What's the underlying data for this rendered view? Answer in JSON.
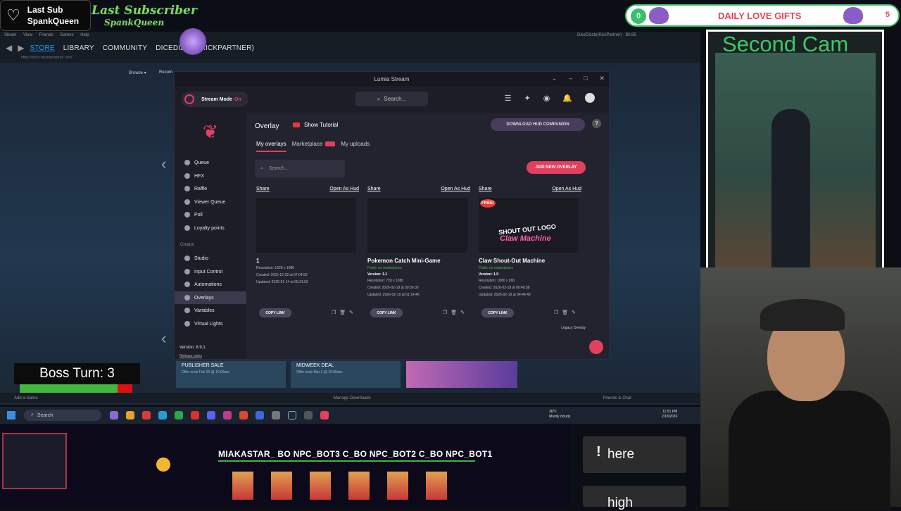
{
  "steam": {
    "menu": [
      "Steam",
      "View",
      "Friends",
      "Games",
      "Help"
    ],
    "nav": [
      "STORE",
      "LIBRARY",
      "COMMUNITY",
      "DICEDIZZLE(KICKPARTNER)"
    ],
    "url": "https://store.steampowered.com/",
    "browse": "Browse ▾",
    "recommended": "Recom",
    "account": "DiceDizzle(KickPartner) · $0.85",
    "tiles": [
      {
        "title": "PUBLISHER SALE",
        "sub": "Offer ends Feb 23 @ 10:00am."
      },
      {
        "title": "MIDWEEK DEAL",
        "sub": "Offer ends Mar 2 @ 10:00am."
      }
    ],
    "add_game": "Add a Game",
    "manage_downloads": "Manage Downloads",
    "friends_chat": "Friends & Chat"
  },
  "lumia": {
    "window_title": "Lumia Stream",
    "stream_mode_label": "Stream Mode",
    "stream_mode_state": "On",
    "search_placeholder": "Search...",
    "notification_count": "2",
    "sidebar": {
      "items": [
        {
          "label": "Queue",
          "icon": "queue-icon"
        },
        {
          "label": "HFX",
          "icon": "hfx-icon"
        },
        {
          "label": "Raffle",
          "icon": "raffle-icon"
        },
        {
          "label": "Viewer Queue",
          "icon": "viewer-queue-icon"
        },
        {
          "label": "Poll",
          "icon": "poll-icon"
        },
        {
          "label": "Loyalty points",
          "icon": "loyalty-icon"
        }
      ],
      "creator_label": "Creator",
      "creator_items": [
        {
          "label": "Studio",
          "icon": "studio-icon"
        },
        {
          "label": "Input Control",
          "icon": "input-control-icon"
        },
        {
          "label": "Automations",
          "icon": "automations-icon"
        },
        {
          "label": "Overlays",
          "icon": "overlays-icon"
        },
        {
          "label": "Variables",
          "icon": "variables-icon"
        },
        {
          "label": "Virtual Lights",
          "icon": "lights-icon"
        }
      ],
      "version": "Version: 8.9.1",
      "release_notes": "Release notes"
    },
    "overlay": {
      "title": "Overlay",
      "tutorial": "Show Tutorial",
      "hud_button": "DOWNLOAD HUD COMPANION",
      "help": "?",
      "tabs": [
        "My overlays",
        "Marketplace",
        "My uploads"
      ],
      "search_placeholder": "Search...",
      "add_button": "ADD NEW OVERLAY",
      "share_label": "Share",
      "open_hud_label": "Open As Hud",
      "copy_label": "COPY LINK",
      "legacy": "Legacy Overlay",
      "cards": [
        {
          "name": "1",
          "public": "",
          "version": "",
          "resolution": "Resolution: 1920 x 1080",
          "created": "Created: 2025-12-22 at 07:04:59",
          "updated": "Updated: 2026-01-14 at 05:31:03"
        },
        {
          "name": "Pokemon Catch Mini-Game",
          "public": "Public on marketplace",
          "version": "Version: 1.1",
          "resolution": "Resolution: 720 x 1080",
          "created": "Created: 2026-02-19 at 00:36:00",
          "updated": "Updated: 2026-02-19 at 01:14:46"
        },
        {
          "name": "Claw Shout-Out Machine",
          "public": "Public on marketplace",
          "version": "Version: 1.0",
          "resolution": "Resolution: 1080 x 900",
          "created": "Created: 2026-02-19 at 00:40:38",
          "updated": "Updated: 2026-02-19 at 04:44:49"
        }
      ],
      "claw_thumb_text1": "SHOUT OUT LOGO",
      "claw_thumb_text2": "Claw Machine",
      "free_badge": "FREE!"
    }
  },
  "stream": {
    "last_sub_label": "Last Sub",
    "last_sub_name": "SpankQueen",
    "banner_title": "Last Subscriber",
    "banner_name": "SpankQueen",
    "gifts_count": "0",
    "gifts_label": "DAILY LOVE GIFTS",
    "gifts_goal": "5",
    "second_cam": "Second Cam",
    "boss_turn": "Boss Turn: 3",
    "boss_health": 0.87,
    "npc_names": "MIAKASTAR_ BO NPC_BOT3 C_BO NPC_BOT2 C_BO NPC_BOT1",
    "chat_line1": "here",
    "chat_line2": "high",
    "chat_excl": "!"
  },
  "taskbar": {
    "search": "Search",
    "weather": "36°F",
    "weather_desc": "Mostly cloudy",
    "time": "11:51 PM",
    "date": "2/18/2026"
  }
}
